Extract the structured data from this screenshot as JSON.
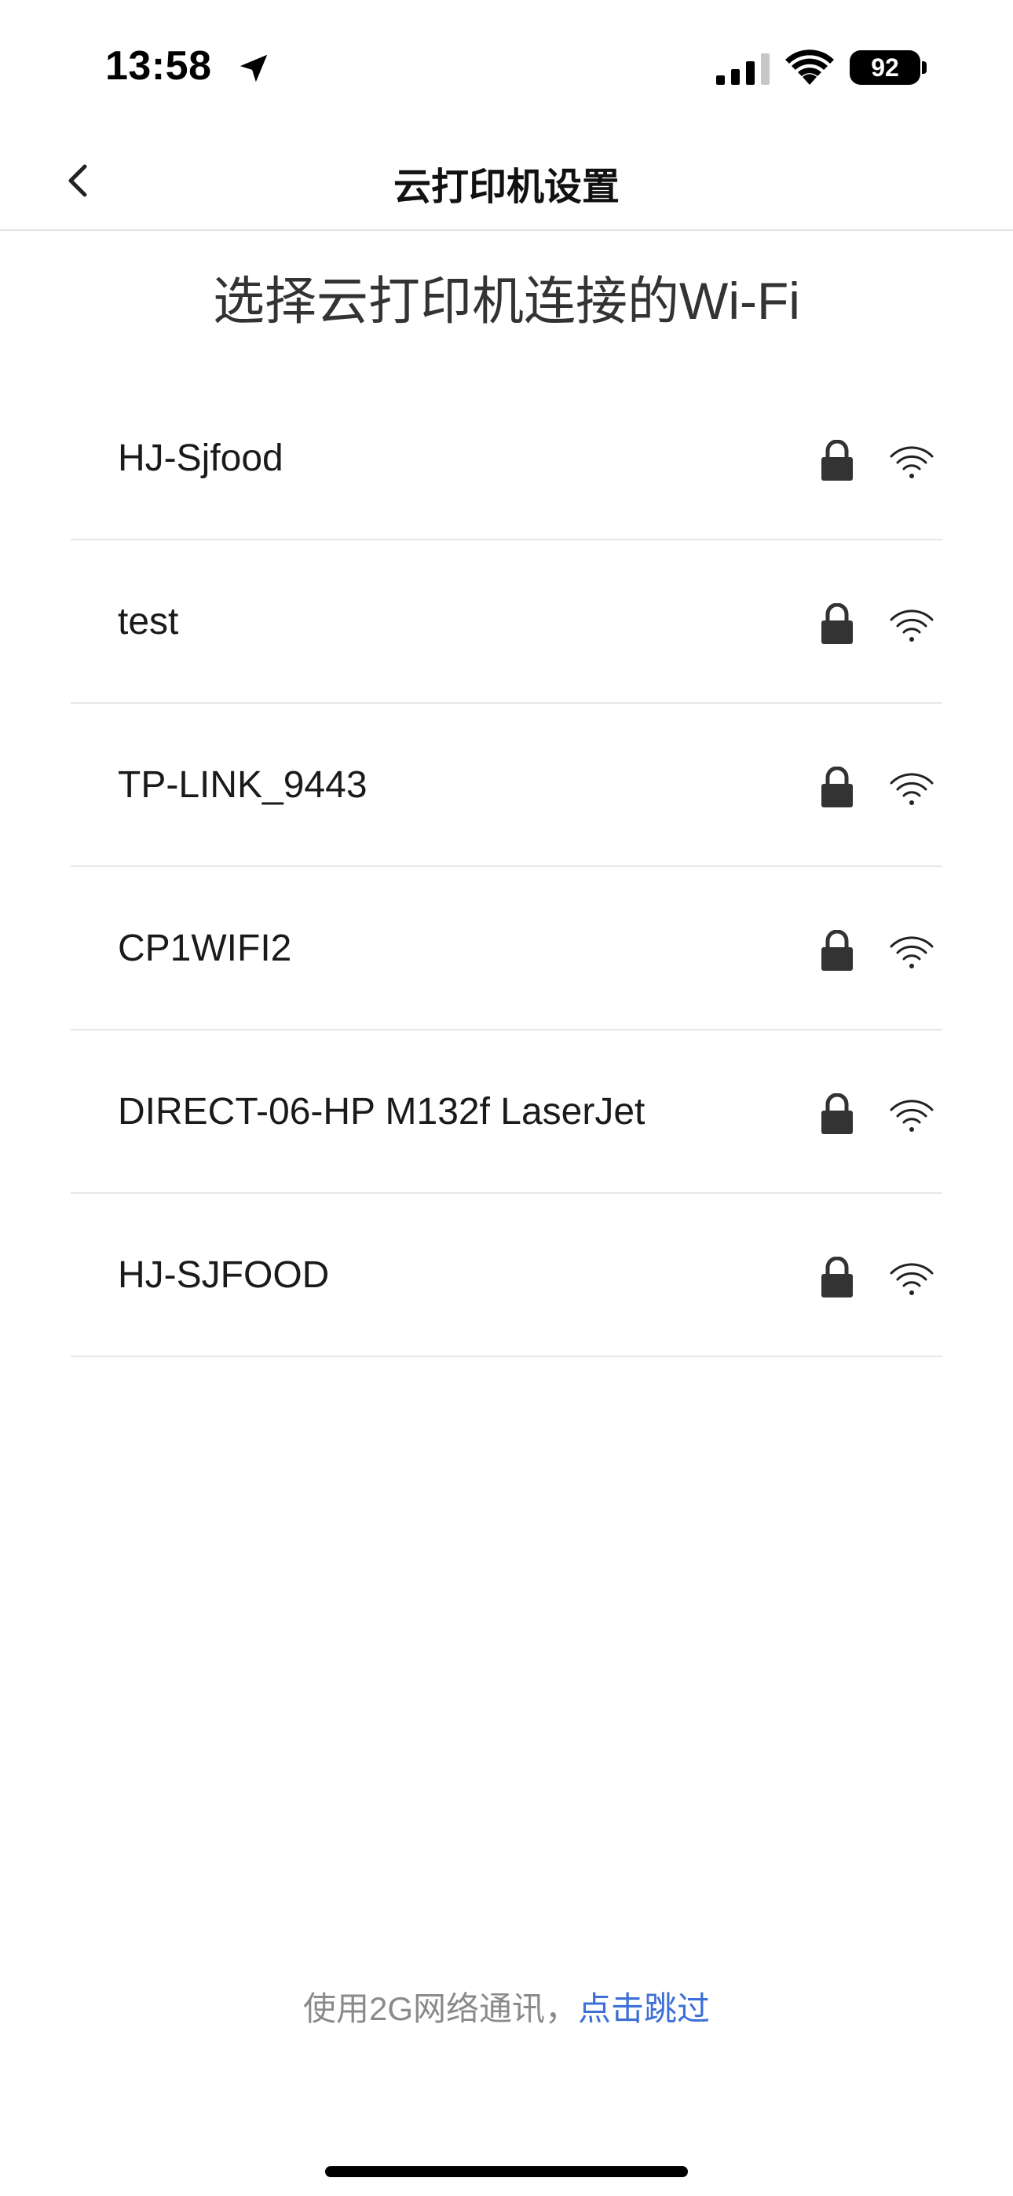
{
  "status_bar": {
    "time": "13:58",
    "battery": "92",
    "icons": [
      "location-arrow-icon",
      "cellular-signal-icon",
      "wifi-icon",
      "battery-icon"
    ]
  },
  "nav": {
    "title": "云打印机设置",
    "back_icon": "chevron-left-icon"
  },
  "heading": "选择云打印机连接的Wi-Fi",
  "wifi_networks": [
    {
      "name": "HJ-Sjfood",
      "secured": true
    },
    {
      "name": "test",
      "secured": true
    },
    {
      "name": "TP-LINK_9443",
      "secured": true
    },
    {
      "name": "CP1WIFI2",
      "secured": true
    },
    {
      "name": "DIRECT-06-HP M132f LaserJet",
      "secured": true
    },
    {
      "name": "HJ-SJFOOD",
      "secured": true
    }
  ],
  "footer": {
    "text": "使用2G网络通讯，",
    "link": "点击跳过"
  },
  "colors": {
    "link": "#3d6fd6",
    "muted_text": "#8a8a8a",
    "divider": "#e6e6e6"
  }
}
